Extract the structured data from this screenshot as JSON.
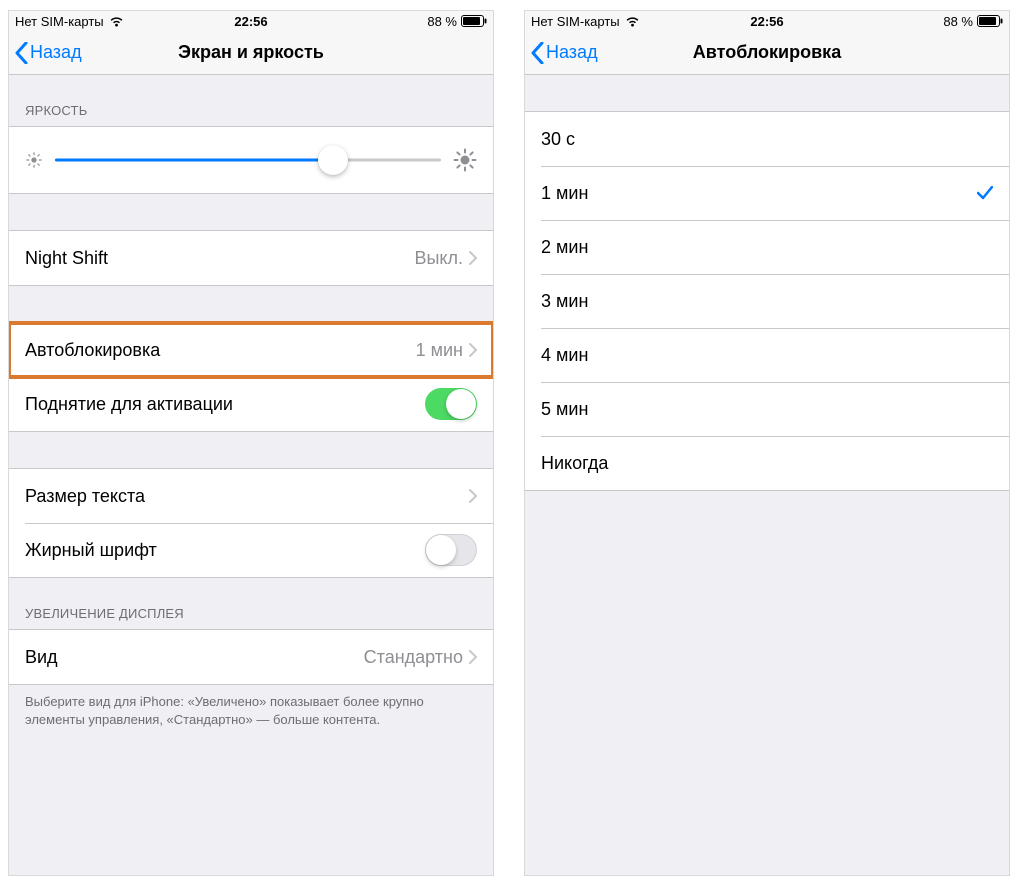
{
  "status": {
    "carrier": "Нет SIM-карты",
    "time": "22:56",
    "battery_pct": "88 %"
  },
  "left": {
    "back_label": "Назад",
    "title": "Экран и яркость",
    "brightness_header": "ЯРКОСТЬ",
    "brightness_value_pct": 72,
    "night_shift": {
      "label": "Night Shift",
      "value": "Выкл."
    },
    "autolock": {
      "label": "Автоблокировка",
      "value": "1 мин"
    },
    "raise_to_wake": {
      "label": "Поднятие для активации",
      "on": true
    },
    "text_size": {
      "label": "Размер текста"
    },
    "bold_text": {
      "label": "Жирный шрифт",
      "on": false
    },
    "zoom_header": "УВЕЛИЧЕНИЕ ДИСПЛЕЯ",
    "view": {
      "label": "Вид",
      "value": "Стандартно"
    },
    "zoom_footer": "Выберите вид для iPhone: «Увеличено» показывает более крупно элементы управления, «Стандартно» — больше контента."
  },
  "right": {
    "back_label": "Назад",
    "title": "Автоблокировка",
    "options": [
      {
        "label": "30 с",
        "selected": false
      },
      {
        "label": "1 мин",
        "selected": true
      },
      {
        "label": "2 мин",
        "selected": false
      },
      {
        "label": "3 мин",
        "selected": false
      },
      {
        "label": "4 мин",
        "selected": false
      },
      {
        "label": "5 мин",
        "selected": false
      },
      {
        "label": "Никогда",
        "selected": false
      }
    ]
  }
}
